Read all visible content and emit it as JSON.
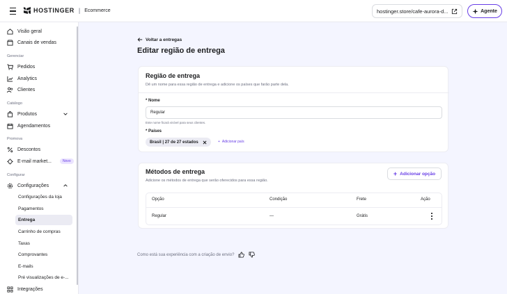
{
  "topbar": {
    "brand": "HOSTINGER",
    "separator": "|",
    "product": "Ecommerce",
    "url": "hostinger.store/cafe-aurora-d...",
    "agent_label": "Agente"
  },
  "sidebar": {
    "items_top": [
      {
        "label": "Visão geral",
        "icon": "home-icon"
      },
      {
        "label": "Canais de vendas",
        "icon": "storefront-icon"
      }
    ],
    "section_gerenciar": "Gerenciar",
    "items_gerenciar": [
      {
        "label": "Pedidos",
        "icon": "cart-icon"
      },
      {
        "label": "Analytics",
        "icon": "chart-icon"
      },
      {
        "label": "Clientes",
        "icon": "users-icon"
      }
    ],
    "section_catalogo": "Catálogo",
    "items_catalogo": [
      {
        "label": "Produtos",
        "icon": "bag-icon"
      },
      {
        "label": "Agendamentos",
        "icon": "calendar-icon"
      }
    ],
    "section_promova": "Promova",
    "items_promova": [
      {
        "label": "Descontos",
        "icon": "percent-icon"
      },
      {
        "label": "E-mail market...",
        "icon": "email-icon",
        "badge": "Novo"
      }
    ],
    "section_configurar": "Configurar",
    "configuracoes_label": "Configurações",
    "sub_items": [
      {
        "label": "Configurações da loja"
      },
      {
        "label": "Pagamentos"
      },
      {
        "label": "Entrega",
        "active": true
      },
      {
        "label": "Carrinho de compras"
      },
      {
        "label": "Taxas"
      },
      {
        "label": "Comprovantes"
      },
      {
        "label": "E-mails"
      },
      {
        "label": "Pré visualizações de e-..."
      }
    ],
    "integracoes_label": "Integrações"
  },
  "main": {
    "back_label": "Voltar a entregas",
    "title": "Editar região de entrega",
    "region_card": {
      "title": "Região de entrega",
      "description": "Dê um nome para essa região de entrega e adicione os países que farão parte dela.",
      "name_label": "* Nome",
      "name_value": "Regular",
      "name_hint": "Este nome ficará visível para seus clientes.",
      "countries_label": "* Países",
      "chip_label": "Brasil | 27 de 27 estados",
      "add_country_label": "Adicionar país"
    },
    "methods_card": {
      "title": "Métodos de entrega",
      "description": "Adicione os métodos de entrega que serão oferecidos para essa região.",
      "add_option_label": "Adicionar opção",
      "columns": [
        "Opção",
        "Condição",
        "Frete",
        "Ação"
      ],
      "rows": [
        {
          "option": "Regular",
          "condition": "—",
          "freight": "Grátis"
        }
      ]
    },
    "feedback_text": "Como está sua experiência com a criação de envio?"
  },
  "colors": {
    "accent": "#673de6",
    "background": "#f4f5ff"
  }
}
